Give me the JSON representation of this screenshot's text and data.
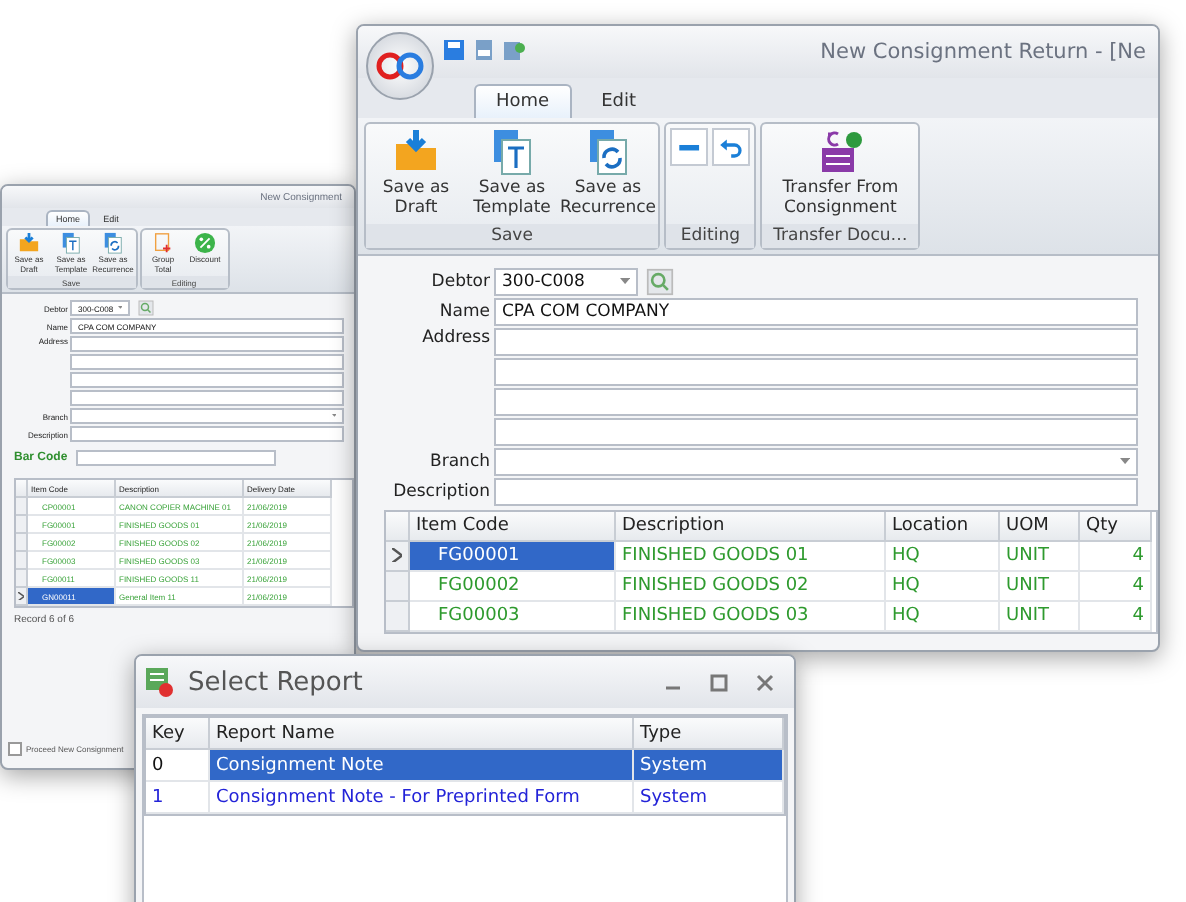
{
  "back_window": {
    "title": "New Consignment",
    "tabs": [
      {
        "label": "Home",
        "selected": true
      },
      {
        "label": "Edit",
        "selected": false
      }
    ],
    "ribbon_groups": [
      {
        "label": "Save",
        "buttons": [
          {
            "label": "Save as Draft",
            "kind": "draft"
          },
          {
            "label": "Save as Template",
            "kind": "template"
          },
          {
            "label": "Save as Recurrence",
            "kind": "recurrence"
          }
        ]
      },
      {
        "label": "Editing",
        "buttons": [
          {
            "label": "Group Total",
            "kind": "group"
          },
          {
            "label": "Discount",
            "kind": "discount"
          }
        ]
      }
    ],
    "form": {
      "debtor": {
        "label": "Debtor",
        "value": "300-C008"
      },
      "name": {
        "label": "Name",
        "value": "CPA COM COMPANY"
      },
      "address": {
        "label": "Address"
      },
      "branch": {
        "label": "Branch"
      },
      "description": {
        "label": "Description"
      }
    },
    "bar_code": {
      "label": "Bar Code"
    },
    "columns": [
      "Item Code",
      "Description",
      "Delivery Date"
    ],
    "rows": [
      {
        "item_code": "CP00001",
        "description": "CANON COPIER MACHINE 01",
        "date": "21/06/2019",
        "selected": false
      },
      {
        "item_code": "FG00001",
        "description": "FINISHED GOODS 01",
        "date": "21/06/2019",
        "selected": false
      },
      {
        "item_code": "FG00002",
        "description": "FINISHED GOODS 02",
        "date": "21/06/2019",
        "selected": false
      },
      {
        "item_code": "FG00003",
        "description": "FINISHED GOODS 03",
        "date": "21/06/2019",
        "selected": false
      },
      {
        "item_code": "FG00011",
        "description": "FINISHED GOODS 11",
        "date": "21/06/2019",
        "selected": false
      },
      {
        "item_code": "GN00011",
        "description": "General Item 11",
        "date": "21/06/2019",
        "selected": true
      }
    ],
    "record_nav": "Record 6 of 6",
    "proceed": {
      "label": "Proceed New Consignment",
      "checked": false
    }
  },
  "main_window": {
    "title": "New Consignment Return - [Ne",
    "tabs": [
      {
        "label": "Home",
        "selected": true
      },
      {
        "label": "Edit",
        "selected": false
      }
    ],
    "ribbon_groups": [
      {
        "label": "Save",
        "buttons": [
          {
            "label": "Save as Draft",
            "kind": "draft"
          },
          {
            "label": "Save as Template",
            "kind": "template"
          },
          {
            "label": "Save as Recurrence",
            "kind": "recurrence"
          }
        ]
      },
      {
        "label": "Editing",
        "buttons": [
          {
            "kind": "remove"
          },
          {
            "kind": "undo"
          }
        ]
      },
      {
        "label": "Transfer Docu…",
        "buttons": [
          {
            "label": "Transfer From Consignment",
            "kind": "transfer"
          }
        ]
      }
    ],
    "form": {
      "debtor": {
        "label": "Debtor",
        "value": "300-C008"
      },
      "name": {
        "label": "Name",
        "value": "CPA COM COMPANY"
      },
      "address": {
        "label": "Address"
      },
      "branch": {
        "label": "Branch"
      },
      "description": {
        "label": "Description"
      }
    },
    "columns": [
      "Item Code",
      "Description",
      "Location",
      "UOM",
      "Qty"
    ],
    "rows": [
      {
        "item_code": "FG00001",
        "description": "FINISHED GOODS 01",
        "location": "HQ",
        "uom": "UNIT",
        "qty": "4",
        "selected": true
      },
      {
        "item_code": "FG00002",
        "description": "FINISHED GOODS 02",
        "location": "HQ",
        "uom": "UNIT",
        "qty": "4",
        "selected": false
      },
      {
        "item_code": "FG00003",
        "description": "FINISHED GOODS 03",
        "location": "HQ",
        "uom": "UNIT",
        "qty": "4",
        "selected": false
      }
    ]
  },
  "report_dialog": {
    "title": "Select Report",
    "columns": [
      "Key",
      "Report Name",
      "Type"
    ],
    "rows": [
      {
        "key": "0",
        "name": "Consignment Note",
        "type": "System",
        "selected": true
      },
      {
        "key": "1",
        "name": "Consignment Note - For Preprinted Form",
        "type": "System",
        "selected": false
      }
    ]
  }
}
